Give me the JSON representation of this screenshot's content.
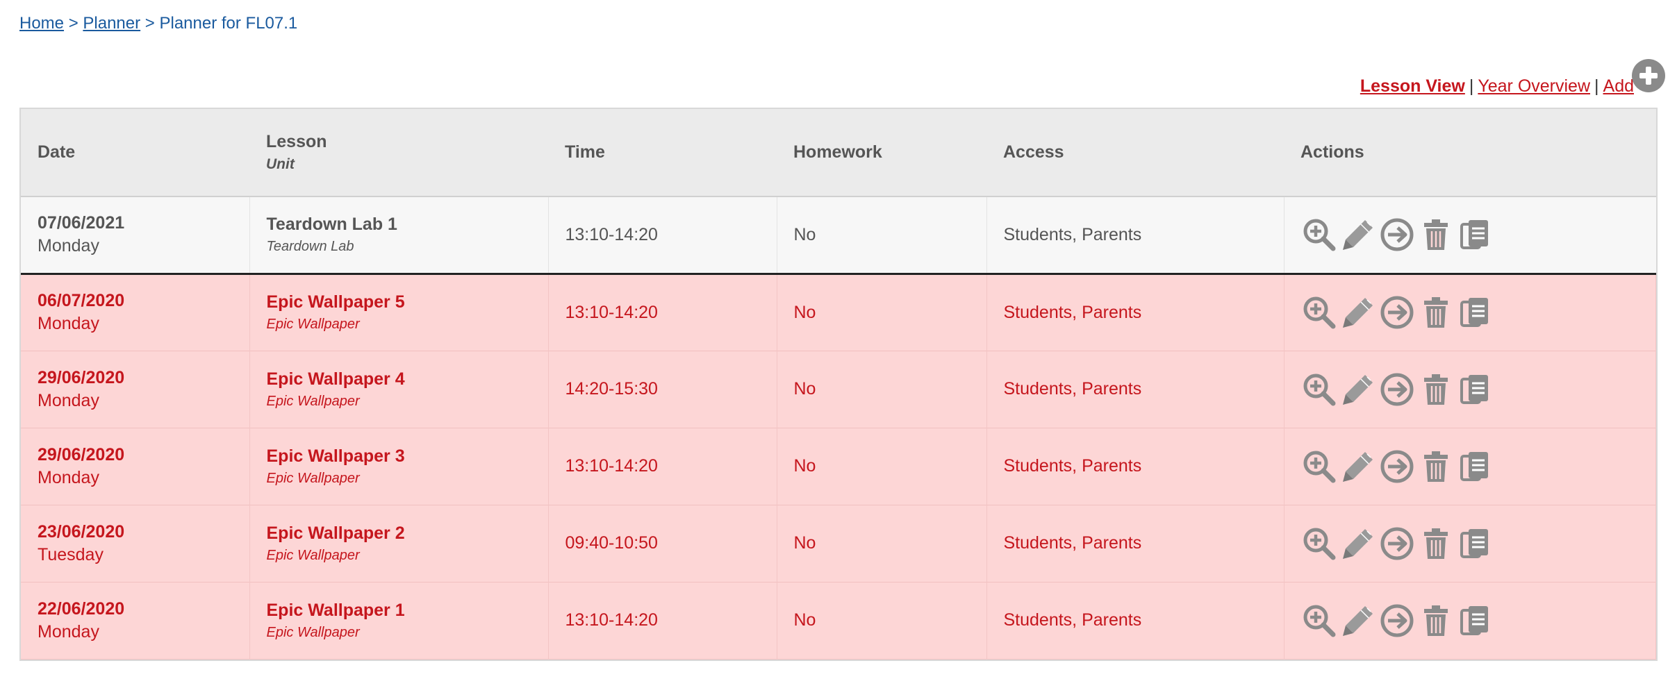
{
  "breadcrumb": {
    "home": "Home",
    "sep1": ">",
    "planner": "Planner",
    "sep2": ">",
    "current": "Planner for FL07.1"
  },
  "view_links": {
    "lesson_view": "Lesson View",
    "sep1": "|",
    "year_overview": "Year Overview",
    "sep2": "|",
    "add": "Add"
  },
  "table": {
    "headers": {
      "date": "Date",
      "lesson": "Lesson",
      "unit": "Unit",
      "time": "Time",
      "homework": "Homework",
      "access": "Access",
      "actions": "Actions"
    },
    "rows": [
      {
        "date": "07/06/2021",
        "day": "Monday",
        "lesson": "Teardown Lab 1",
        "unit": "Teardown Lab",
        "time": "13:10-14:20",
        "homework": "No",
        "access": "Students, Parents"
      },
      {
        "date": "06/07/2020",
        "day": "Monday",
        "lesson": "Epic Wallpaper 5",
        "unit": "Epic Wallpaper",
        "time": "13:10-14:20",
        "homework": "No",
        "access": "Students, Parents"
      },
      {
        "date": "29/06/2020",
        "day": "Monday",
        "lesson": "Epic Wallpaper 4",
        "unit": "Epic Wallpaper",
        "time": "14:20-15:30",
        "homework": "No",
        "access": "Students, Parents"
      },
      {
        "date": "29/06/2020",
        "day": "Monday",
        "lesson": "Epic Wallpaper 3",
        "unit": "Epic Wallpaper",
        "time": "13:10-14:20",
        "homework": "No",
        "access": "Students, Parents"
      },
      {
        "date": "23/06/2020",
        "day": "Tuesday",
        "lesson": "Epic Wallpaper 2",
        "unit": "Epic Wallpaper",
        "time": "09:40-10:50",
        "homework": "No",
        "access": "Students, Parents"
      },
      {
        "date": "22/06/2020",
        "day": "Monday",
        "lesson": "Epic Wallpaper 1",
        "unit": "Epic Wallpaper",
        "time": "13:10-14:20",
        "homework": "No",
        "access": "Students, Parents"
      }
    ]
  },
  "icons": {
    "add": "add-circle-icon",
    "view": "zoom-in-icon",
    "edit": "pencil-icon",
    "go": "arrow-right-circle-icon",
    "delete": "trash-icon",
    "duplicate": "copy-icon"
  },
  "colors": {
    "link_blue": "#1a5a9e",
    "link_red": "#c5161d",
    "past_row_bg": "#fdd6d6",
    "icon_gray": "#8a8a8a"
  }
}
